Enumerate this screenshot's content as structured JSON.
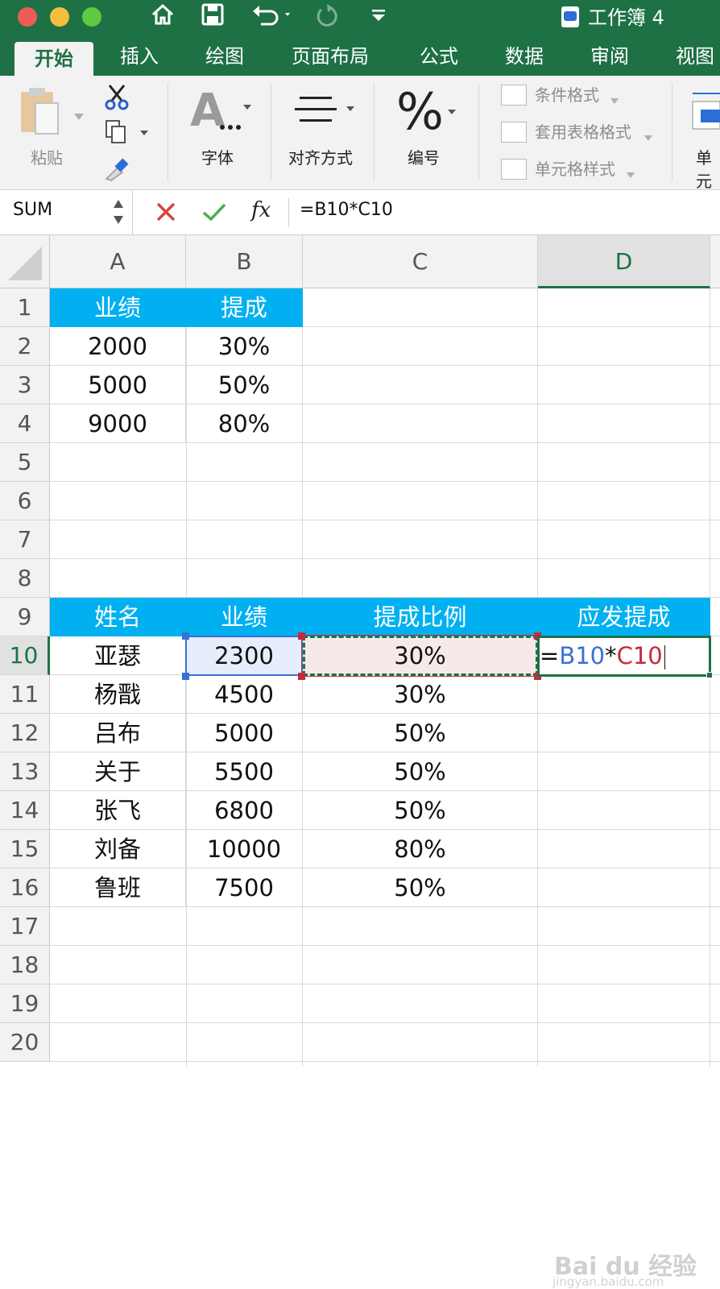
{
  "window": {
    "title": "工作簿 4",
    "traffic_colors": [
      "#ee5d55",
      "#f6be3f",
      "#5fc93f"
    ]
  },
  "toolbar_icons": [
    "home-icon",
    "save-icon",
    "undo-icon",
    "redo-icon",
    "customize-icon"
  ],
  "tabs": [
    "开始",
    "插入",
    "绘图",
    "页面布局",
    "公式",
    "数据",
    "审阅",
    "视图"
  ],
  "active_tab": "开始",
  "ribbon": {
    "paste": "粘贴",
    "font": "字体",
    "align": "对齐方式",
    "number": "编号",
    "cond_format": "条件格式",
    "table_format": "套用表格格式",
    "cell_style": "单元格样式",
    "cells_partial": "单元"
  },
  "formula_bar": {
    "name_box": "SUM",
    "fx": "fx",
    "formula": "=B10*C10"
  },
  "columns": [
    "A",
    "B",
    "C",
    "D"
  ],
  "rows": [
    "1",
    "2",
    "3",
    "4",
    "5",
    "6",
    "7",
    "8",
    "9",
    "10",
    "11",
    "12",
    "13",
    "14",
    "15",
    "16",
    "17",
    "18",
    "19",
    "20"
  ],
  "table1": {
    "headers": [
      "业绩",
      "提成"
    ],
    "rows": [
      [
        "2000",
        "30%"
      ],
      [
        "5000",
        "50%"
      ],
      [
        "9000",
        "80%"
      ]
    ]
  },
  "table2": {
    "headers": [
      "姓名",
      "业绩",
      "提成比例",
      "应发提成"
    ],
    "rows": [
      [
        "亚瑟",
        "2300",
        "30%"
      ],
      [
        "杨戬",
        "4500",
        "30%"
      ],
      [
        "吕布",
        "5000",
        "50%"
      ],
      [
        "关于",
        "5500",
        "50%"
      ],
      [
        "张飞",
        "6800",
        "50%"
      ],
      [
        "刘备",
        "10000",
        "80%"
      ],
      [
        "鲁班",
        "7500",
        "50%"
      ]
    ]
  },
  "active_cell": {
    "ref": "D10",
    "eq": "=",
    "ref1": "B10",
    "op": "*",
    "ref2": "C10"
  },
  "colors": {
    "excel_green": "#1e7145",
    "header_fill": "#00b0f0",
    "ref_blue": "#3a6fd8",
    "ref_red": "#c42b3c"
  },
  "watermark": {
    "main": "Bai du 经验",
    "sub": "jingyan.baidu.com"
  }
}
